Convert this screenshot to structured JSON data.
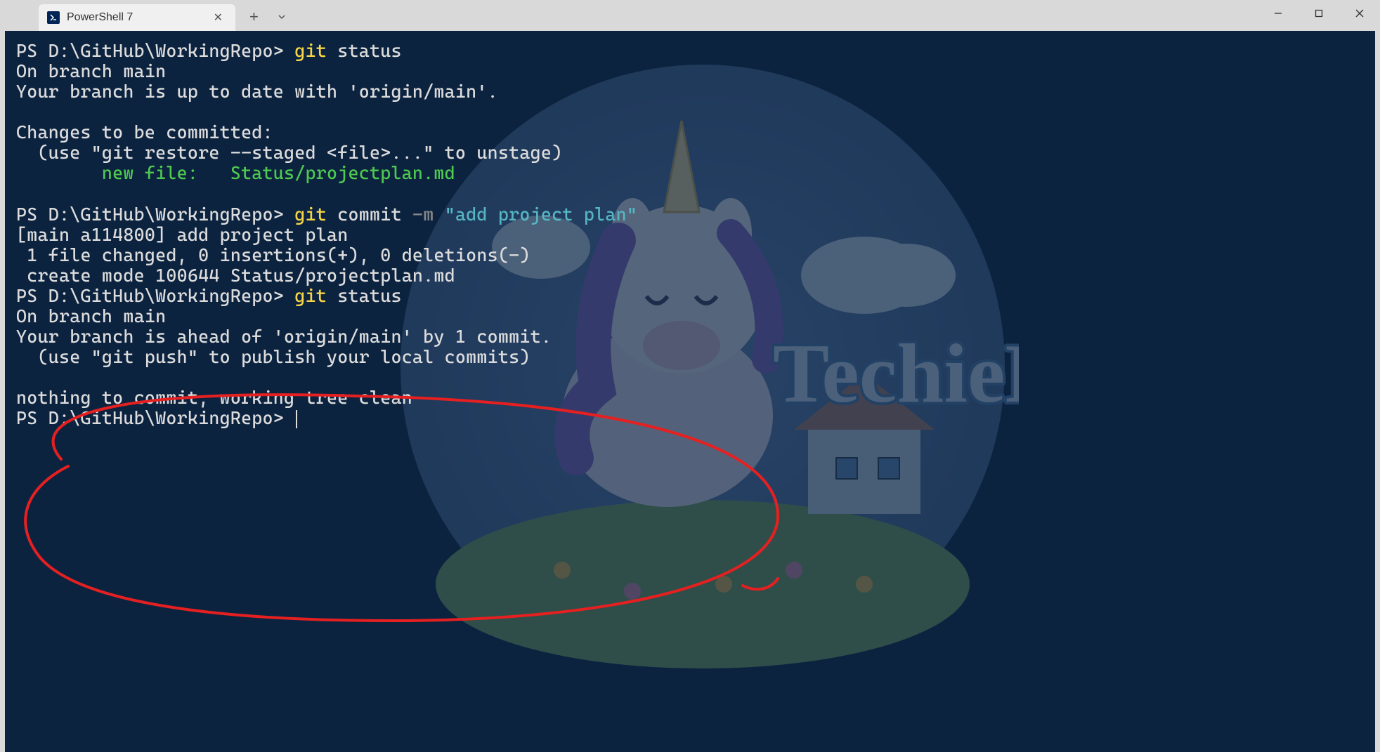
{
  "tab": {
    "title": "PowerShell 7",
    "icon_text": "≥"
  },
  "prompt": "PS D:\\GitHub\\WorkingRepo>",
  "lines": {
    "cmd1_git": "git",
    "cmd1_status": " status",
    "status1_branch": "On branch main",
    "status1_uptodate": "Your branch is up to date with 'origin/main'.",
    "status1_changes_header": "Changes to be committed:",
    "status1_unstage_hint": "  (use \"git restore --staged <file>...\" to unstage)",
    "status1_newfile_label": "        new file:   Status/projectplan.md",
    "cmd2_git": "git",
    "cmd2_commit": " commit",
    "cmd2_flag": " -m",
    "cmd2_msg": " \"add project plan\"",
    "commit_result1": "[main a114800] add project plan",
    "commit_result2": " 1 file changed, 0 insertions(+), 0 deletions(-)",
    "commit_result3": " create mode 100644 Status/projectplan.md",
    "cmd3_git": "git",
    "cmd3_status": " status",
    "status2_branch": "On branch main",
    "status2_ahead": "Your branch is ahead of 'origin/main' by 1 commit.",
    "status2_push_hint": "  (use \"git push\" to publish your local commits)",
    "status2_clean": "nothing to commit, working tree clean"
  },
  "watermark_text": "TechieLass"
}
